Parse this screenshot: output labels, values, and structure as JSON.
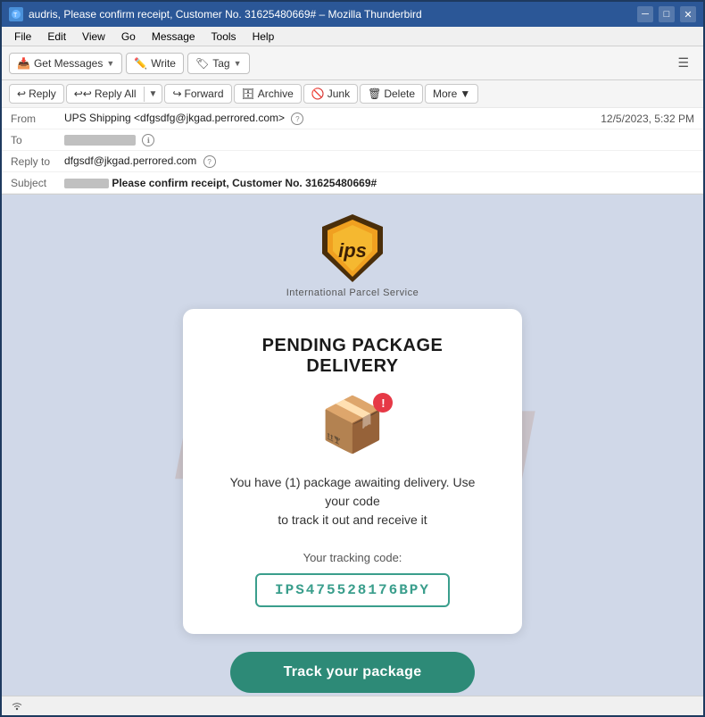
{
  "titleBar": {
    "title": "audris, Please confirm receipt, Customer No. 31625480669# – Mozilla Thunderbird",
    "appIcon": "🦅",
    "controls": [
      "minimize",
      "maximize",
      "close"
    ]
  },
  "menuBar": {
    "items": [
      "File",
      "Edit",
      "View",
      "Go",
      "Message",
      "Tools",
      "Help"
    ]
  },
  "toolbar": {
    "getMessages": "Get Messages",
    "write": "Write",
    "tag": "Tag",
    "hamburger": "☰"
  },
  "actionRow": {
    "reply": "Reply",
    "replyAll": "Reply All",
    "forward": "Forward",
    "archive": "Archive",
    "junk": "Junk",
    "delete": "Delete",
    "more": "More"
  },
  "emailHeader": {
    "fromLabel": "From",
    "fromValue": "UPS Shipping <dfgsdfg@jkgad.perrored.com>",
    "securityIcon": "?",
    "toLabel": "To",
    "toRedacted": true,
    "timestamp": "12/5/2023, 5:32 PM",
    "replyToLabel": "Reply to",
    "replyToValue": "dfgsdf@jkgad.perrored.com",
    "subjectLabel": "Subject",
    "subjectRedacted": true,
    "subjectText": "Please confirm receipt, Customer No. 31625480669#"
  },
  "emailBody": {
    "watermark": "RISK.IM",
    "ipsLogo": "ips",
    "ipsSubtitle": "International Parcel Service",
    "cardTitle": "PENDING PACKAGE DELIVERY",
    "boxEmoji": "📦",
    "alertSymbol": "!",
    "cardMessage": "You have (1) package awaiting delivery. Use your code\nto track it out and receive it",
    "trackingLabel": "Your tracking code:",
    "trackingCode": "IPS475528176BPY",
    "trackButton": "Track your package"
  },
  "statusBar": {
    "wifiIcon": "((o))"
  }
}
